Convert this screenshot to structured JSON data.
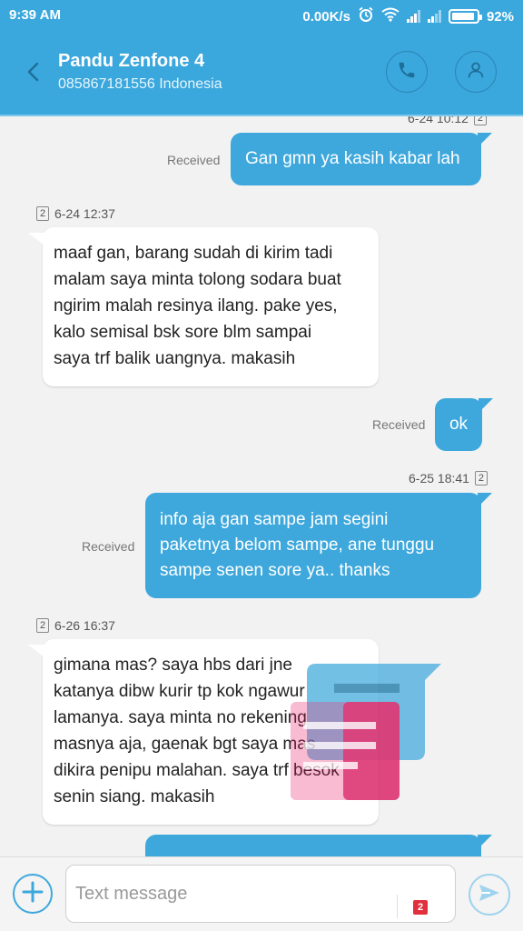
{
  "status_bar": {
    "time": "9:39 AM",
    "net_speed": "0.00K/s",
    "battery": "92%",
    "battery_level": 0.92
  },
  "header": {
    "contact_name": "Pandu Zenfone 4",
    "contact_sub": "085867181556 Indonesia"
  },
  "messages": {
    "m1": {
      "stamp": "6-24 10:12",
      "sim": "2",
      "status": "Received",
      "text": "Gan gmn ya kasih kabar lah"
    },
    "m2": {
      "stamp": "6-24 12:37",
      "sim": "2",
      "lines": [
        "maaf gan, barang sudah di kirim tadi",
        "malam saya minta tolong sodara buat",
        "ngirim malah resinya ilang. pake yes,",
        "kalo semisal bsk sore blm sampai",
        "saya trf balik uangnya. makasih"
      ]
    },
    "m3": {
      "status": "Received",
      "text": "ok"
    },
    "m4": {
      "stamp": "6-25 18:41",
      "sim": "2",
      "status": "Received",
      "lines": [
        "info aja gan sampe jam segini",
        "paketnya belom sampe, ane tunggu",
        "sampe senen sore ya.. thanks"
      ]
    },
    "m5": {
      "stamp": "6-26 16:37",
      "sim": "2",
      "lines": [
        "gimana mas? saya hbs dari jne",
        "katanya dibw kurir tp kok ngawur",
        "lamanya. saya minta no rekening",
        "masnya aja, gaenak bgt saya mas",
        "dikira penipu malahan. saya trf besok",
        "senin siang. makasih"
      ]
    }
  },
  "composer": {
    "placeholder": "Text message",
    "sim": "2"
  },
  "colors": {
    "header": "#3aa7dd",
    "outgoing_bubble": "#3ea8dc",
    "incoming_bubble": "#ffffff",
    "sim_badge": "#e0303d"
  },
  "icons": [
    "back-icon",
    "phone-icon",
    "person-icon",
    "add-icon",
    "send-icon",
    "alarm-icon",
    "wifi-icon",
    "signal-icon",
    "battery-icon"
  ]
}
